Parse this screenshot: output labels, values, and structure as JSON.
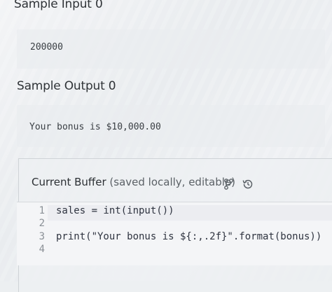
{
  "sample_input": {
    "heading": "Sample Input 0",
    "value": "200000"
  },
  "sample_output": {
    "heading": "Sample Output 0",
    "value": "Your bonus is $10,000.00"
  },
  "buffer": {
    "title": "Current Buffer",
    "note": "(saved locally, editable)",
    "icons": [
      "branch-icon",
      "history-icon"
    ]
  },
  "editor": {
    "lines": [
      {
        "number": "1",
        "code": "sales = int(input())"
      },
      {
        "number": "2",
        "code": ""
      },
      {
        "number": "3",
        "code": "print(\"Your bonus is ${:,.2f}\".format(bonus))"
      },
      {
        "number": "4",
        "code": ""
      }
    ]
  }
}
